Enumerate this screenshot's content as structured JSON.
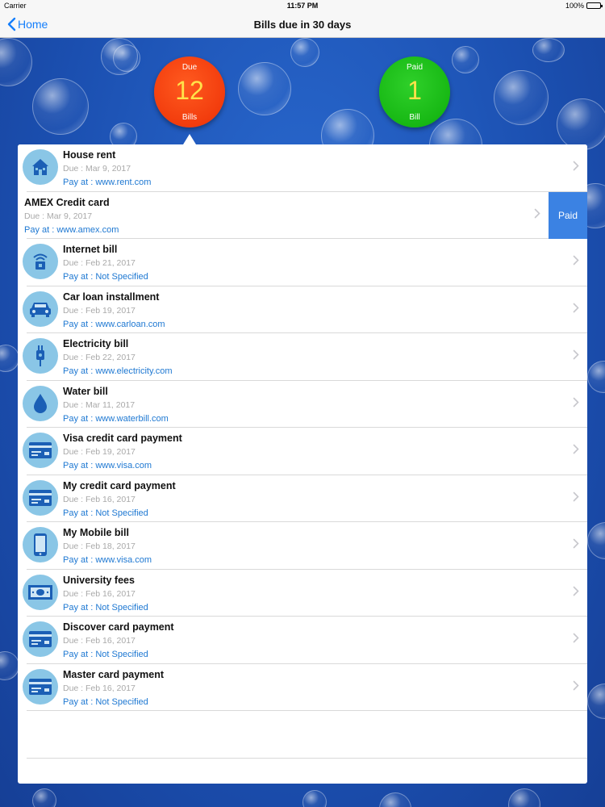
{
  "status": {
    "carrier": "Carrier",
    "time": "11:57 PM",
    "battery": "100%"
  },
  "nav": {
    "back_label": "Home",
    "title": "Bills due in 30 days"
  },
  "counters": {
    "due": {
      "top": "Due",
      "count": "12",
      "bottom": "Bills",
      "color": "#f23c0d"
    },
    "paid": {
      "top": "Paid",
      "count": "1",
      "bottom": "Bill",
      "color": "#17b814"
    }
  },
  "swipe_action_label": "Paid",
  "bills": [
    {
      "title": "House rent",
      "due": "Due : Mar 9, 2017",
      "pay": "Pay at : www.rent.com",
      "icon": "house-icon"
    },
    {
      "title": "AMEX Credit card",
      "due": "Due : Mar 9, 2017",
      "pay": "Pay at : www.amex.com",
      "icon": "credit-card-icon"
    },
    {
      "title": "Internet bill",
      "due": "Due : Feb 21, 2017",
      "pay": "Pay at : Not Specified",
      "icon": "wifi-router-icon"
    },
    {
      "title": "Car loan installment",
      "due": "Due : Feb 19, 2017",
      "pay": "Pay at : www.carloan.com",
      "icon": "car-icon"
    },
    {
      "title": "Electricity bill",
      "due": "Due : Feb 22, 2017",
      "pay": "Pay at : www.electricity.com",
      "icon": "plug-icon"
    },
    {
      "title": "Water bill",
      "due": "Due : Mar 11, 2017",
      "pay": "Pay at : www.waterbill.com",
      "icon": "water-drop-icon"
    },
    {
      "title": "Visa credit card payment",
      "due": "Due : Feb 19, 2017",
      "pay": "Pay at : www.visa.com",
      "icon": "credit-card-icon"
    },
    {
      "title": "My credit card payment",
      "due": "Due : Feb 16, 2017",
      "pay": "Pay at : Not Specified",
      "icon": "credit-card-icon"
    },
    {
      "title": "My Mobile bill",
      "due": "Due : Feb 18, 2017",
      "pay": "Pay at : www.visa.com",
      "icon": "mobile-phone-icon"
    },
    {
      "title": "University fees",
      "due": "Due : Feb 16, 2017",
      "pay": "Pay at : Not Specified",
      "icon": "banknote-icon"
    },
    {
      "title": "Discover card payment",
      "due": "Due : Feb 16, 2017",
      "pay": "Pay at : Not Specified",
      "icon": "credit-card-icon"
    },
    {
      "title": "Master card payment",
      "due": "Due : Feb 16, 2017",
      "pay": "Pay at : Not Specified",
      "icon": "credit-card-icon"
    }
  ]
}
